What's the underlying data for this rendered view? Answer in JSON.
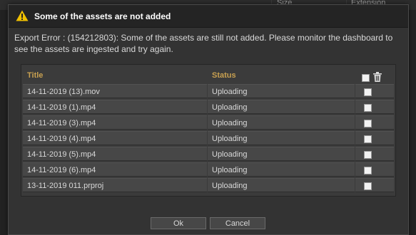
{
  "background": {
    "columns": [
      "Size",
      "Extension"
    ]
  },
  "dialog": {
    "title": "Some of the assets are not added",
    "message": "Export Error : (154212803): Some of the assets are still not added. Please monitor the dashboard to see the assets are ingested and try again.",
    "table": {
      "headers": {
        "title": "Title",
        "status": "Status"
      },
      "rows": [
        {
          "title": "14-11-2019 (13).mov",
          "status": "Uploading"
        },
        {
          "title": "14-11-2019 (1).mp4",
          "status": "Uploading"
        },
        {
          "title": "14-11-2019 (3).mp4",
          "status": "Uploading"
        },
        {
          "title": "14-11-2019 (4).mp4",
          "status": "Uploading"
        },
        {
          "title": "14-11-2019 (5).mp4",
          "status": "Uploading"
        },
        {
          "title": "14-11-2019 (6).mp4",
          "status": "Uploading"
        },
        {
          "title": "13-11-2019 011.prproj",
          "status": "Uploading"
        }
      ]
    },
    "buttons": {
      "ok": "Ok",
      "cancel": "Cancel"
    }
  },
  "colors": {
    "header_text": "#c8a050",
    "warning": "#f0c000"
  },
  "icons": {
    "warning": "warning-icon",
    "trash": "trash-icon"
  }
}
